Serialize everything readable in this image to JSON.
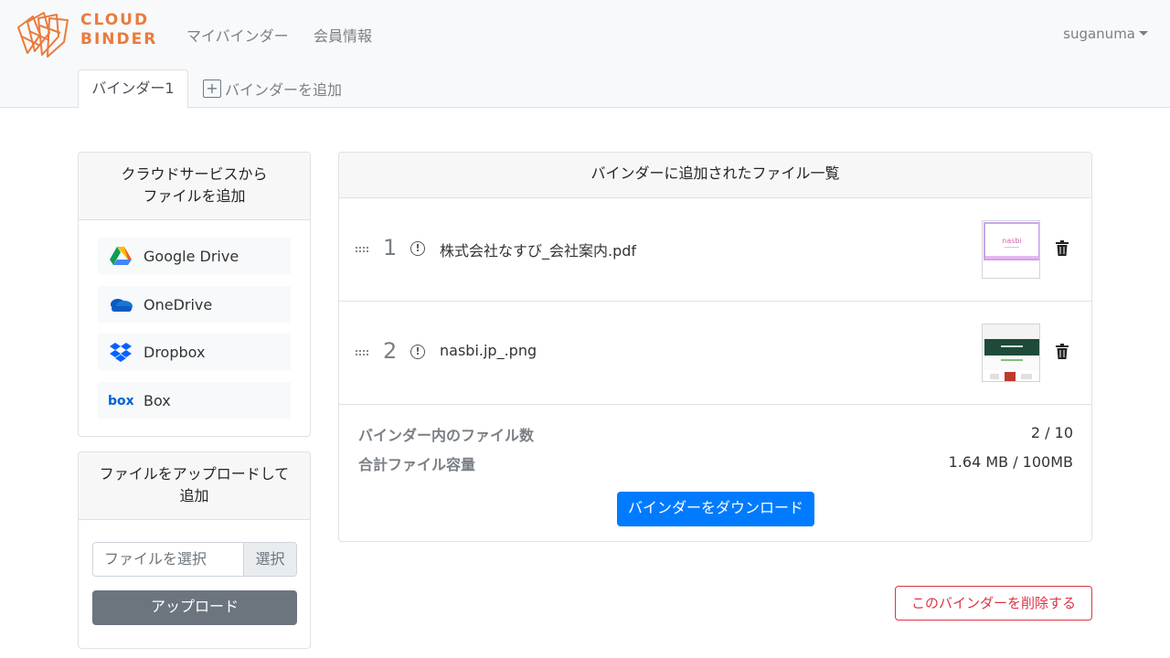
{
  "header": {
    "logo_line1": "CLOUD",
    "logo_line2": "BINDER",
    "nav": [
      {
        "label": "マイバインダー"
      },
      {
        "label": "会員情報"
      }
    ],
    "user": "suganuma"
  },
  "tabs": {
    "active": "バインダー1",
    "add": "バインダーを追加"
  },
  "cloud_card": {
    "title_line1": "クラウドサービスから",
    "title_line2": "ファイルを追加",
    "services": [
      {
        "label": "Google Drive",
        "icon": "google-drive-icon"
      },
      {
        "label": "OneDrive",
        "icon": "onedrive-icon"
      },
      {
        "label": "Dropbox",
        "icon": "dropbox-icon"
      },
      {
        "label": "Box",
        "icon": "box-icon"
      }
    ]
  },
  "upload_card": {
    "title_line1": "ファイルをアップロードして",
    "title_line2": "追加",
    "placeholder": "ファイルを選択",
    "browse": "選択",
    "upload": "アップロード"
  },
  "list_card": {
    "title": "バインダーに追加されたファイル一覧",
    "files": [
      {
        "num": "1",
        "name": "株式会社なすび_会社案内.pdf",
        "thumb_text": "nasbi"
      },
      {
        "num": "2",
        "name": "nasbi.jp_.png"
      }
    ],
    "count_label": "バインダー内のファイル数",
    "count_value": "2 / 10",
    "size_label": "合計ファイル容量",
    "size_value": "1.64 MB / 100MB",
    "download": "バインダーをダウンロード"
  },
  "delete_binder": "このバインダーを削除する",
  "colors": {
    "brand": "#ea7b3c",
    "primary": "#007bff",
    "danger": "#dc3545",
    "secondary": "#6c757d"
  }
}
